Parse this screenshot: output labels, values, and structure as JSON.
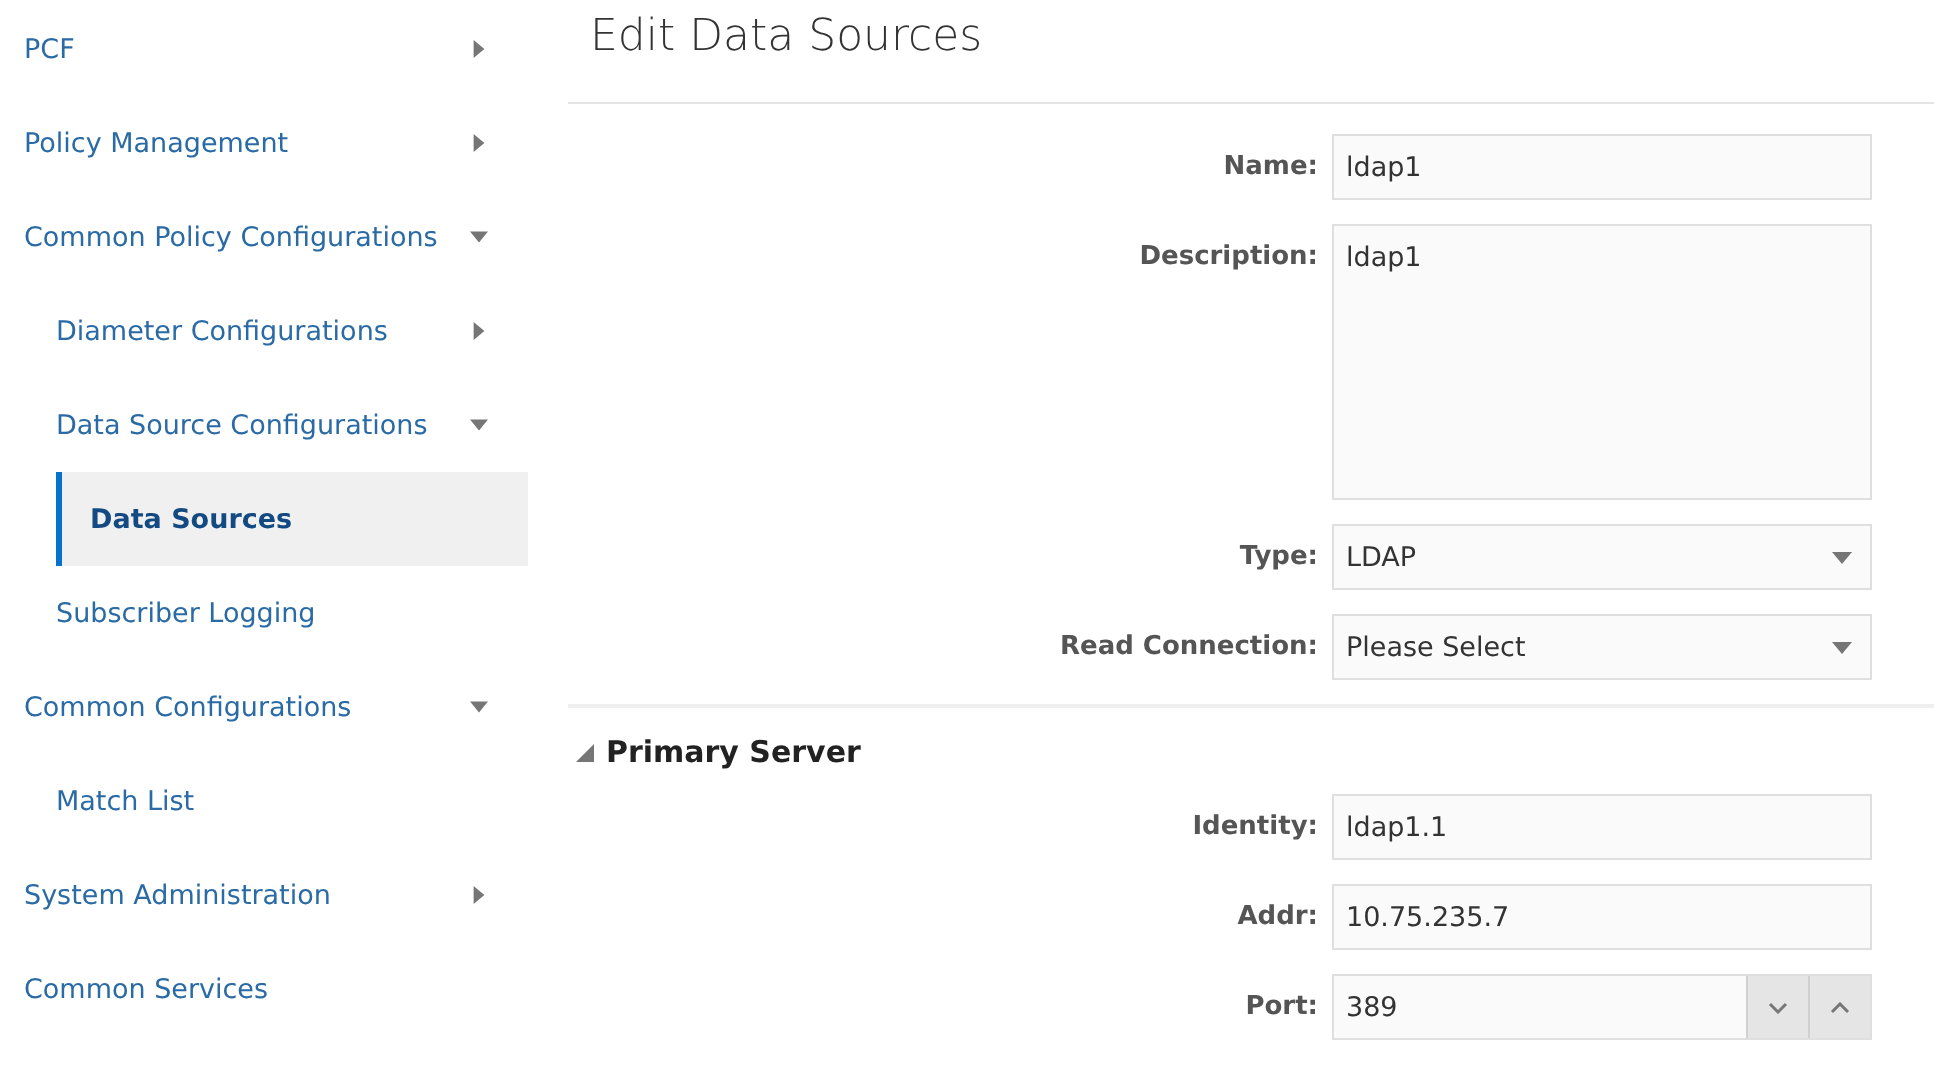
{
  "sidebar": {
    "items": [
      {
        "label": "PCF",
        "expanded": false,
        "selected": false
      },
      {
        "label": "Policy Management",
        "expanded": false,
        "selected": false
      },
      {
        "label": "Common Policy Configurations",
        "expanded": true,
        "selected": false,
        "children": [
          {
            "label": "Diameter Configurations",
            "expanded": false,
            "selected": false
          },
          {
            "label": "Data Source Configurations",
            "expanded": true,
            "selected": false,
            "children": [
              {
                "label": "Data Sources",
                "selected": true
              }
            ]
          },
          {
            "label": "Subscriber Logging",
            "selected": false
          }
        ]
      },
      {
        "label": "Common Configurations",
        "expanded": true,
        "selected": false,
        "children": [
          {
            "label": "Match List",
            "selected": false
          }
        ]
      },
      {
        "label": "System Administration",
        "expanded": false,
        "selected": false
      },
      {
        "label": "Common Services",
        "selected": false
      }
    ]
  },
  "page": {
    "title": "Edit Data Sources"
  },
  "form": {
    "fields": [
      {
        "kind": "text",
        "label": "Name:",
        "value": "ldap1"
      },
      {
        "kind": "textarea",
        "label": "Description:",
        "value": "ldap1"
      },
      {
        "kind": "select",
        "label": "Type:",
        "value": "LDAP"
      },
      {
        "kind": "select",
        "label": "Read Connection:",
        "value": "Please Select"
      }
    ]
  },
  "primary_server": {
    "title": "Primary Server",
    "expanded": true,
    "fields": [
      {
        "kind": "text",
        "label": "Identity:",
        "value": "ldap1.1"
      },
      {
        "kind": "text",
        "label": "Addr:",
        "value": "10.75.235.7"
      },
      {
        "kind": "number",
        "label": "Port:",
        "value": "389"
      }
    ]
  }
}
